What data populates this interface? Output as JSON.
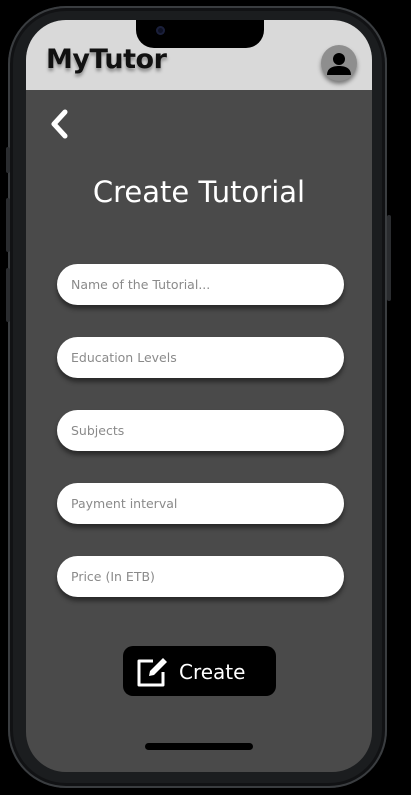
{
  "app": {
    "name": "MyTutor"
  },
  "page": {
    "title": "Create Tutorial"
  },
  "form": {
    "fields": [
      {
        "name": "tutorial-name-input",
        "placeholder": "Name of the Tutorial...",
        "value": ""
      },
      {
        "name": "education-levels-input",
        "placeholder": "Education Levels",
        "value": ""
      },
      {
        "name": "subjects-input",
        "placeholder": "Subjects",
        "value": ""
      },
      {
        "name": "payment-interval-input",
        "placeholder": "Payment interval",
        "value": ""
      },
      {
        "name": "price-input",
        "placeholder": "Price (In ETB)",
        "value": ""
      }
    ],
    "submit_label": "Create"
  },
  "icons": {
    "back": "chevron-left-icon",
    "avatar": "user-avatar-icon",
    "create": "edit-icon"
  },
  "colors": {
    "header_bg": "#d9d9d9",
    "screen_bg": "#4a4a4a",
    "field_bg": "#ffffff",
    "button_bg": "#000000",
    "button_text": "#ffffff"
  }
}
